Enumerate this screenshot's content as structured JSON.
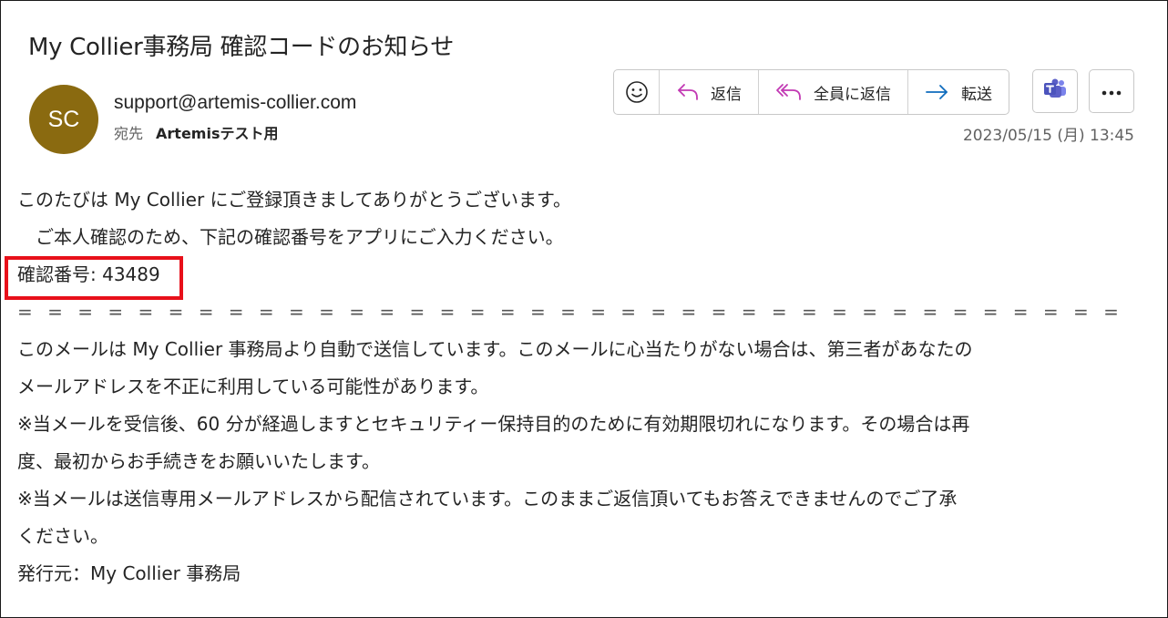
{
  "email": {
    "subject": "My Collier事務局 確認コードのお知らせ",
    "avatar_initials": "SC",
    "avatar_color": "#8a6a10",
    "sender": "support@artemis-collier.com",
    "to_label": "宛先",
    "to_name": "Artemisテスト用",
    "timestamp": "2023/05/15 (月) 13:45"
  },
  "toolbar": {
    "emoji_icon": "smiley-icon",
    "reply_label": "返信",
    "reply_all_label": "全員に返信",
    "forward_label": "転送",
    "teams_icon": "teams-icon",
    "more_icon": "more-horizontal-icon"
  },
  "body": {
    "line1": "このたびは My Collier にご登録頂きましてありがとうございます。",
    "line2": "　ご本人確認のため、下記の確認番号をアプリにご入力ください。",
    "code_line": "確認番号: 43489",
    "separator": "= = = = = = = = = = = = = = = = = = = = = = = = = = = = = = = = = = = = =",
    "line4a": "このメールは My Collier 事務局より自動で送信しています。このメールに心当たりがない場合は、第三者があなたの",
    "line4b": "メールアドレスを不正に利用している可能性があります。",
    "line5a": "※当メールを受信後、60 分が経過しますとセキュリティー保持目的のために有効期限切れになります。その場合は再",
    "line5b": "度、最初からお手続きをお願いいたします。",
    "line6a": "※当メールは送信専用メールアドレスから配信されています。このままご返信頂いてもお答えできませんのでご了承",
    "line6b": "ください。",
    "line7": "発行元：My Collier 事務局"
  },
  "colors": {
    "highlight_box": "#e8101a",
    "reply_arrow": "#c239b3",
    "forward_arrow": "#0f6cbd",
    "teams": "#5b5fc7"
  }
}
